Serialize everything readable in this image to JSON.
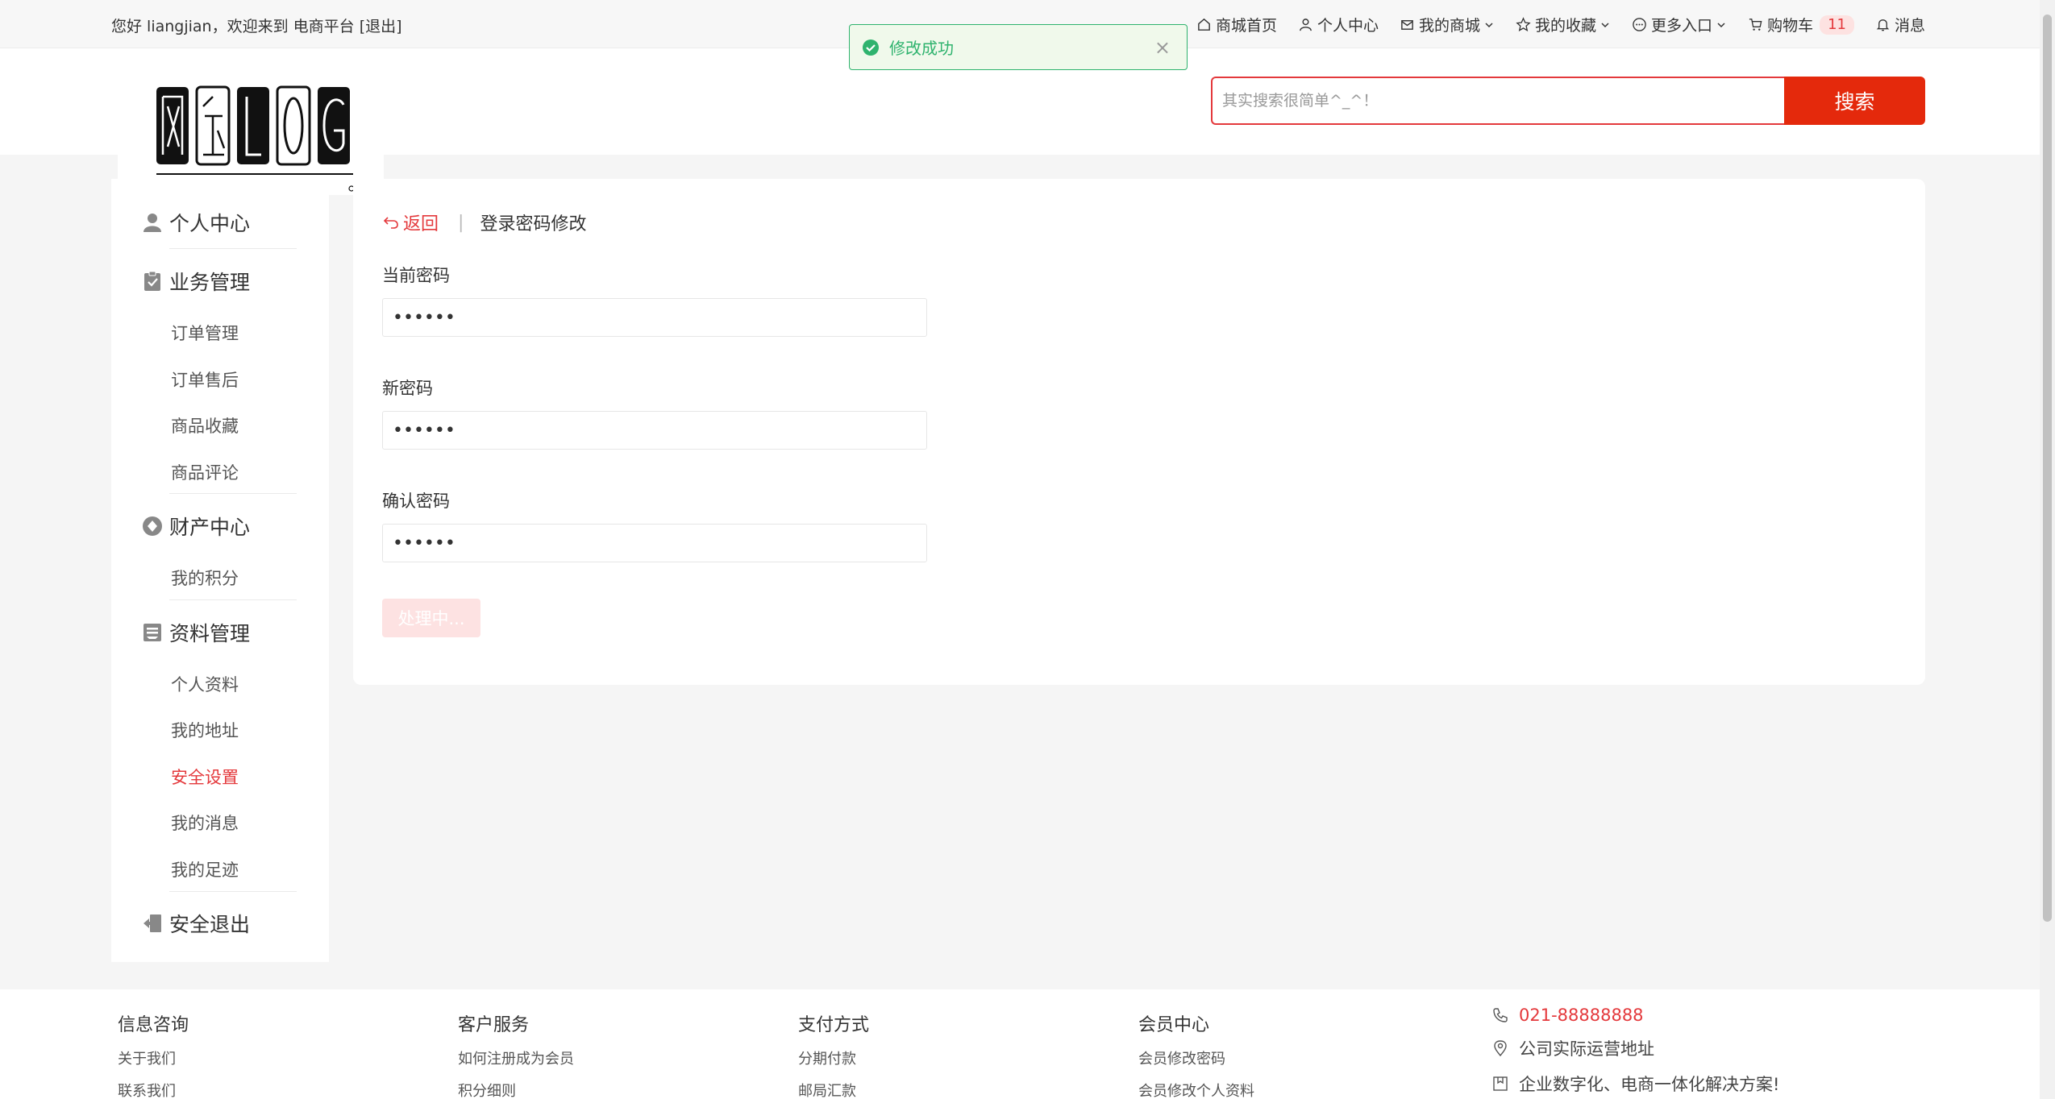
{
  "topbar": {
    "welcome": "您好 liangjian，欢迎来到 电商平台",
    "logout": "[退出]",
    "nav": [
      {
        "label": "商城首页",
        "icon": "home-icon"
      },
      {
        "label": "个人中心",
        "icon": "user-icon"
      },
      {
        "label": "我的商城",
        "icon": "mail-icon"
      },
      {
        "label": "我的收藏",
        "icon": "star-icon"
      },
      {
        "label": "更多入口",
        "icon": "more-icon"
      },
      {
        "label": "购物车",
        "icon": "cart-icon"
      },
      {
        "label": "消息",
        "icon": "bell-icon"
      }
    ],
    "cart_count": "11"
  },
  "search": {
    "placeholder": "其实搜索很简单^_^！",
    "button": "搜索"
  },
  "toast": {
    "message": "修改成功",
    "close": "×"
  },
  "sidebar": {
    "groups": [
      {
        "title": "个人中心",
        "icon": "user-icon",
        "items": []
      },
      {
        "title": "业务管理",
        "icon": "clipboard-check-icon",
        "items": [
          "订单管理",
          "订单售后",
          "商品收藏",
          "商品评论"
        ]
      },
      {
        "title": "财产中心",
        "icon": "coin-icon",
        "items": [
          "我的积分"
        ]
      },
      {
        "title": "资料管理",
        "icon": "profile-card-icon",
        "items": [
          "个人资料",
          "我的地址",
          "安全设置",
          "我的消息",
          "我的足迹"
        ]
      },
      {
        "title": "安全退出",
        "icon": "logout-icon",
        "items": []
      }
    ],
    "active_item": "安全设置"
  },
  "main": {
    "back": "返回",
    "separator": "|",
    "title": "登录密码修改",
    "fields": [
      {
        "label": "当前密码",
        "value": "••••••"
      },
      {
        "label": "新密码",
        "value": "••••••"
      },
      {
        "label": "确认密码",
        "value": "••••••"
      }
    ],
    "submit": "处理中..."
  },
  "footer": {
    "columns": [
      {
        "title": "信息咨询",
        "links": [
          "关于我们",
          "联系我们"
        ]
      },
      {
        "title": "客户服务",
        "links": [
          "如何注册成为会员",
          "积分细则"
        ]
      },
      {
        "title": "支付方式",
        "links": [
          "分期付款",
          "邮局汇款"
        ]
      },
      {
        "title": "会员中心",
        "links": [
          "会员修改密码",
          "会员修改个人资料"
        ]
      }
    ],
    "contact": {
      "phone": "021-88888888",
      "address": "公司实际运营地址",
      "slogan": "企业数字化、电商一体化解决方案!"
    }
  },
  "colors": {
    "accent": "#e4393c",
    "success": "#2fb36e"
  }
}
